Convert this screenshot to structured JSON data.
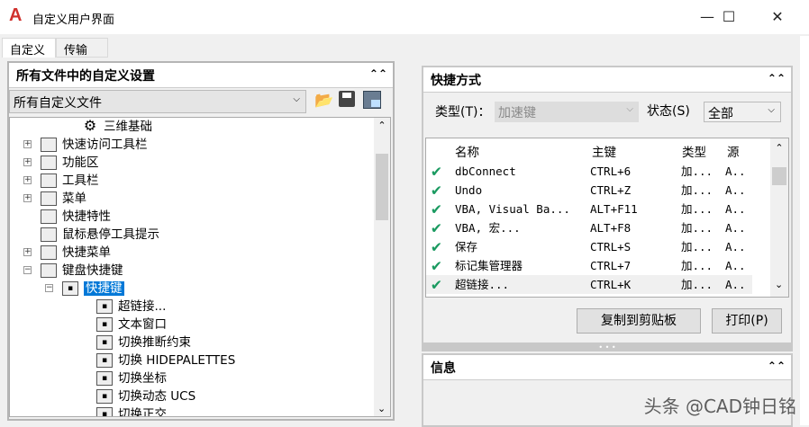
{
  "window": {
    "title": "自定义用户界面",
    "minimize": "—",
    "maximize": "☐",
    "close": "✕"
  },
  "tabs": [
    {
      "label": "自定义"
    },
    {
      "label": "传输"
    }
  ],
  "left": {
    "header": "所有文件中的自定义设置",
    "file_combo": "所有自定义文件",
    "tree": [
      {
        "label": "三维基础",
        "icon": "gear-icon",
        "level": 3,
        "exp": ""
      },
      {
        "label": "快速访问工具栏",
        "icon": "toolbar-icon",
        "level": 2,
        "exp": "+"
      },
      {
        "label": "功能区",
        "icon": "ribbon-icon",
        "level": 2,
        "exp": "+"
      },
      {
        "label": "工具栏",
        "icon": "toolbar-icon",
        "level": 2,
        "exp": "+"
      },
      {
        "label": "菜单",
        "icon": "menu-icon",
        "level": 2,
        "exp": "+"
      },
      {
        "label": "快捷特性",
        "icon": "properties-icon",
        "level": 2,
        "exp": ""
      },
      {
        "label": "鼠标悬停工具提示",
        "icon": "tooltip-icon",
        "level": 2,
        "exp": ""
      },
      {
        "label": "快捷菜单",
        "icon": "shortcut-menu-icon",
        "level": 2,
        "exp": "+"
      },
      {
        "label": "键盘快捷键",
        "icon": "keyboard-icon",
        "level": 2,
        "exp": "−"
      },
      {
        "label": "快捷键",
        "icon": "key-icon",
        "level": 3,
        "exp": "−",
        "selected": true
      },
      {
        "label": "超链接...",
        "icon": "key-icon",
        "level": 4,
        "exp": ""
      },
      {
        "label": "文本窗口",
        "icon": "key-icon",
        "level": 4,
        "exp": ""
      },
      {
        "label": "切换推断约束",
        "icon": "key-icon",
        "level": 4,
        "exp": ""
      },
      {
        "label": "切换 HIDEPALETTES",
        "icon": "key-icon",
        "level": 4,
        "exp": ""
      },
      {
        "label": "切换坐标",
        "icon": "key-icon",
        "level": 4,
        "exp": ""
      },
      {
        "label": "切换动态 UCS",
        "icon": "key-icon",
        "level": 4,
        "exp": ""
      },
      {
        "label": "切换正交",
        "icon": "key-icon",
        "level": 4,
        "exp": ""
      }
    ]
  },
  "shortcuts": {
    "header": "快捷方式",
    "type_label": "类型(T)：",
    "type_value": "加速键",
    "status_label": "状态(S)",
    "status_value": "全部",
    "columns": [
      "名称",
      "主键",
      "类型",
      "源"
    ],
    "rows": [
      {
        "name": "dbConnect",
        "key": "CTRL+6",
        "type": "加...",
        "src": "A.."
      },
      {
        "name": "Undo",
        "key": "CTRL+Z",
        "type": "加...",
        "src": "A.."
      },
      {
        "name": "VBA, Visual Ba...",
        "key": "ALT+F11",
        "type": "加...",
        "src": "A.."
      },
      {
        "name": "VBA, 宏...",
        "key": "ALT+F8",
        "type": "加...",
        "src": "A.."
      },
      {
        "name": "保存",
        "key": "CTRL+S",
        "type": "加...",
        "src": "A.."
      },
      {
        "name": "标记集管理器",
        "key": "CTRL+7",
        "type": "加...",
        "src": "A.."
      },
      {
        "name": "超链接...",
        "key": "CTRL+K",
        "type": "加...",
        "src": "A.."
      }
    ],
    "copy_button": "复制到剪贴板",
    "print_button": "打印(P)"
  },
  "info": {
    "header": "信息"
  },
  "watermark": "头条 @CAD钟日铭"
}
